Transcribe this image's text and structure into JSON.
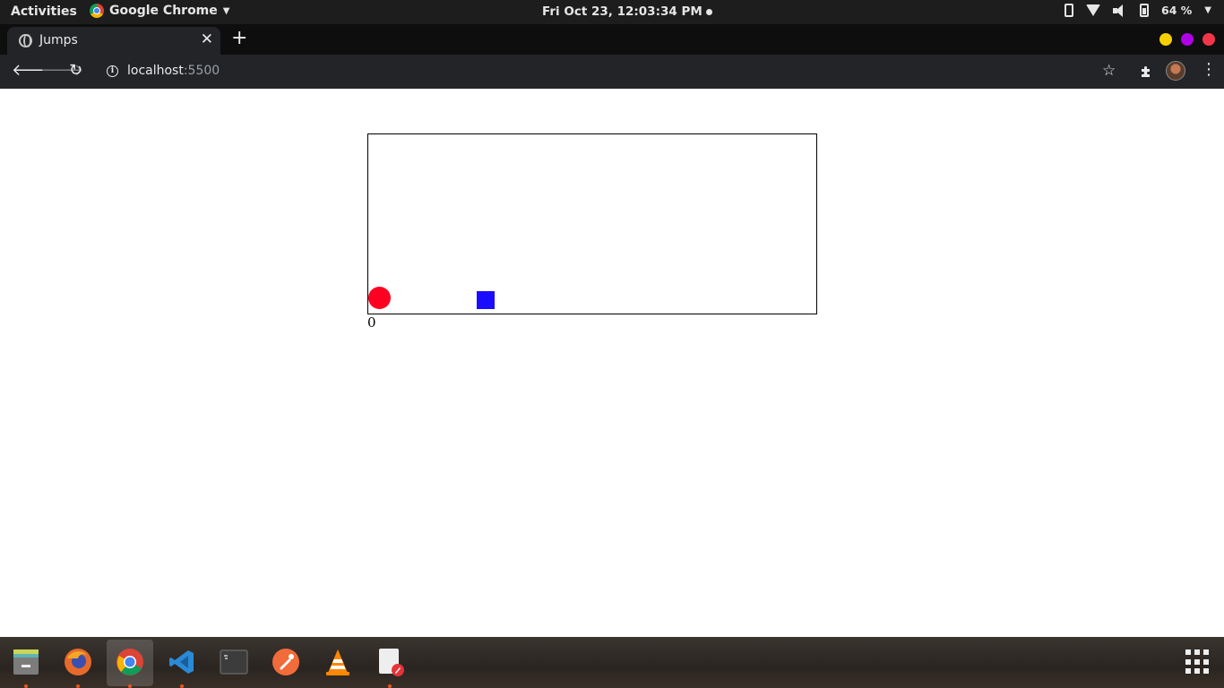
{
  "topbar": {
    "activities": "Activities",
    "app_name": "Google Chrome",
    "clock": "Fri Oct 23, 12:03:34 PM",
    "battery": "64 %"
  },
  "browser": {
    "tab_title": "Jumps",
    "url_host": "localhost",
    "url_port": ":5500"
  },
  "game": {
    "score": "0",
    "player_color": "#ff0022",
    "obstacle_color": "#1a0dff"
  },
  "window_controls": [
    "#f5d000",
    "#b000e6",
    "#f2364a"
  ],
  "dock": {
    "items": [
      {
        "name": "files-icon",
        "running": true
      },
      {
        "name": "firefox-icon",
        "running": true
      },
      {
        "name": "chrome-icon",
        "running": true,
        "active": true
      },
      {
        "name": "vscode-icon",
        "running": true
      },
      {
        "name": "terminal-icon",
        "running": false
      },
      {
        "name": "postman-icon",
        "running": false
      },
      {
        "name": "vlc-icon",
        "running": false
      },
      {
        "name": "text-editor-icon",
        "running": true
      }
    ]
  }
}
